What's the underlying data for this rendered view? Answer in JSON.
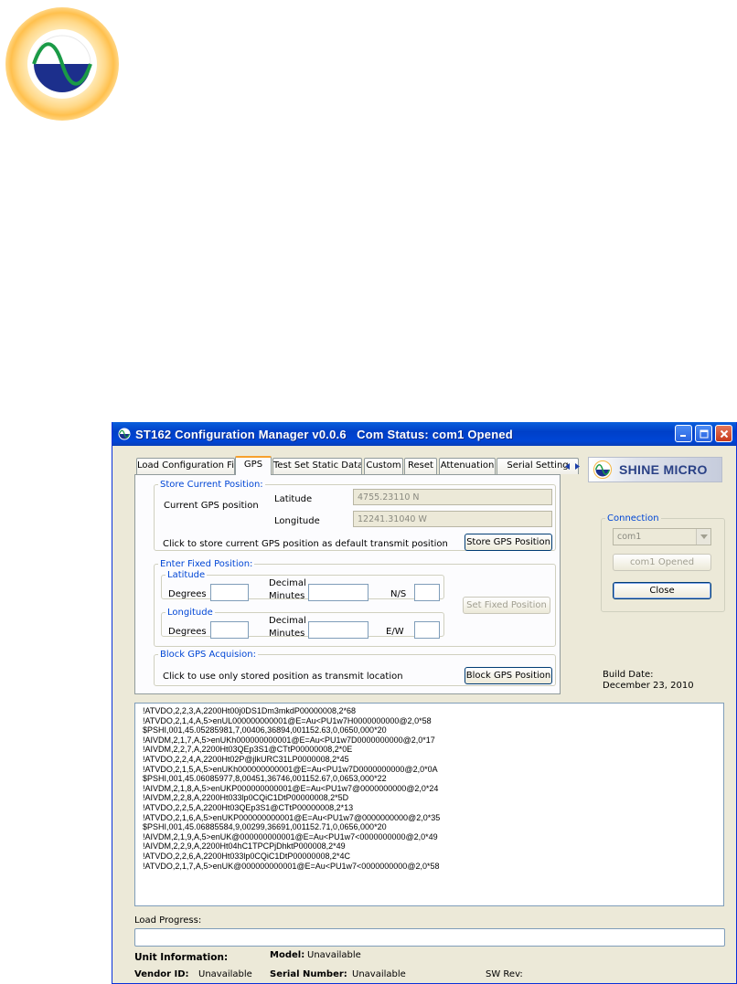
{
  "window": {
    "title": "ST162 Configuration Manager v0.0.6   Com Status: com1 Opened",
    "controls": [
      "minimize",
      "maximize",
      "close"
    ]
  },
  "tabs": [
    {
      "label": "Load Configuration File",
      "active": false
    },
    {
      "label": "GPS",
      "active": true
    },
    {
      "label": "Test Set Static Data",
      "active": false
    },
    {
      "label": "Custom",
      "active": false
    },
    {
      "label": "Reset",
      "active": false
    },
    {
      "label": "Attenuation",
      "active": false
    },
    {
      "label": "Serial Setting",
      "active": false
    }
  ],
  "gps": {
    "store_group": "Store Current Position:",
    "current_label": "Current GPS position",
    "latitude_label": "Latitude",
    "latitude_value": "4755.23110  N",
    "longitude_label": "Longitude",
    "longitude_value": "12241.31040  W",
    "store_hint": "Click to store current GPS position as default transmit position",
    "store_button": "Store GPS Position",
    "fixed_group": "Enter Fixed Position:",
    "lat_sub": "Latitude",
    "lon_sub": "Longitude",
    "degrees_label": "Degrees",
    "decimal_label": "Decimal",
    "minutes_label": "Minutes",
    "ns_label": "N/S",
    "ew_label": "E/W",
    "set_fixed_button": "Set Fixed Position",
    "block_group": "Block GPS Acquision:",
    "block_hint": "Click to use only stored position as transmit location",
    "block_button": "Block GPS Position"
  },
  "brand": {
    "name": "SHINE MICRO"
  },
  "connection": {
    "group": "Connection",
    "port": "com1",
    "status_button": "com1 Opened",
    "close_button": "Close"
  },
  "build": {
    "label": "Build Date:",
    "date": "December 23, 2010"
  },
  "log_lines": [
    "!ATVDO,2,2,3,A,2200Ht00j0DS1Dm3mkdP00000008,2*68",
    "!ATVDO,2,1,4,A,5>enUL000000000001@E=Au<PU1w7H0000000000@2,0*58",
    "$PSHI,001,45.05285981,7,00406,36894,001152.63,0,0650,000*20",
    "!AIVDM,2,1,7,A,5>enUKh000000000001@E=Au<PU1w7D0000000000@2,0*17",
    "!AIVDM,2,2,7,A,2200Ht03QEp3S1@CTtP00000008,2*0E",
    "!ATVDO,2,2,4,A,2200Ht02P@jlkURC31LP0000008,2*45",
    "!ATVDO,2,1,5,A,5>enUKh000000000001@E=Au<PU1w7D0000000000@2,0*0A",
    "$PSHI,001,45.06085977,8,00451,36746,001152.67,0,0653,000*22",
    "!AIVDM,2,1,8,A,5>enUKP000000000001@E=Au<PU1w7@0000000000@2,0*24",
    "!AIVDM,2,2,8,A,2200Ht033lp0CQiC1DtP00000008,2*5D",
    "!ATVDO,2,2,5,A,2200Ht03QEp3S1@CTtP00000008,2*13",
    "!ATVDO,2,1,6,A,5>enUKP000000000001@E=Au<PU1w7@0000000000@2,0*35",
    "$PSHI,001,45.06885584,9,00299,36691,001152.71,0,0656,000*20",
    "!AIVDM,2,1,9,A,5>enUK@000000000001@E=Au<PU1w7<0000000000@2,0*49",
    "!AIVDM,2,2,9,A,2200Ht04hC1TPCPjDhktP000008,2*49",
    "!ATVDO,2,2,6,A,2200Ht033lp0CQiC1DtP00000008,2*4C",
    "!ATVDO,2,1,7,A,5>enUK@000000000001@E=Au<PU1w7<0000000000@2,0*58"
  ],
  "load_progress": {
    "label": "Load Progress:"
  },
  "unit_info": {
    "label": "Unit Information:",
    "model_label": "Model:",
    "model_value": "Unavailable",
    "vendor_label": "Vendor ID:",
    "vendor_value": "Unavailable",
    "serial_label": "Serial Number:",
    "serial_value": "Unavailable",
    "sw_label": "SW Rev:"
  },
  "colors": {
    "titlebar": "#0046d6",
    "group_label": "#0046d5",
    "logo_wave": "#1a9a46",
    "logo_fill": "#1c2f8c"
  }
}
